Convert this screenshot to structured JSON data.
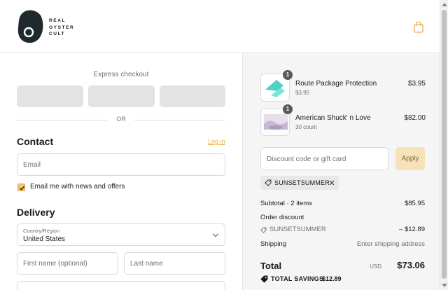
{
  "brand": {
    "name_lines": [
      "REAL",
      "OYSTER",
      "CULT"
    ]
  },
  "header": {
    "cart_icon": "shopping-bag-icon",
    "accent_color": "#e8b04a"
  },
  "checkout": {
    "express_title": "Express checkout",
    "or_text": "OR",
    "contact": {
      "title": "Contact",
      "login_link": "Log in",
      "email_placeholder": "Email",
      "newsletter_label": "Email me with news and offers",
      "newsletter_checked": true
    },
    "delivery": {
      "title": "Delivery",
      "country_label": "Country/Region",
      "country_value": "United States",
      "first_name_placeholder": "First name (optional)",
      "last_name_placeholder": "Last name"
    }
  },
  "summary": {
    "items": [
      {
        "name": "Route Package Protection",
        "sub": "$3.95",
        "price": "$3.95",
        "qty": "1",
        "icon": "route-logo-icon"
      },
      {
        "name": "American Shuck' n Love",
        "sub": "30 count",
        "price": "$82.00",
        "qty": "1",
        "icon": "product-image"
      }
    ],
    "discount_placeholder": "Discount code or gift card",
    "apply_label": "Apply",
    "applied_code": "SUNSETSUMMER",
    "subtotal_label": "Subtotal · 2 items",
    "subtotal_value": "$85.95",
    "order_discount_label": "Order discount",
    "discount_code": "SUNSETSUMMER",
    "discount_value": "– $12.89",
    "shipping_label": "Shipping",
    "shipping_value": "Enter shipping address",
    "total_label": "Total",
    "total_currency": "USD",
    "total_value": "$73.06",
    "savings_label": "TOTAL SAVINGS",
    "savings_value": "$12.89"
  }
}
